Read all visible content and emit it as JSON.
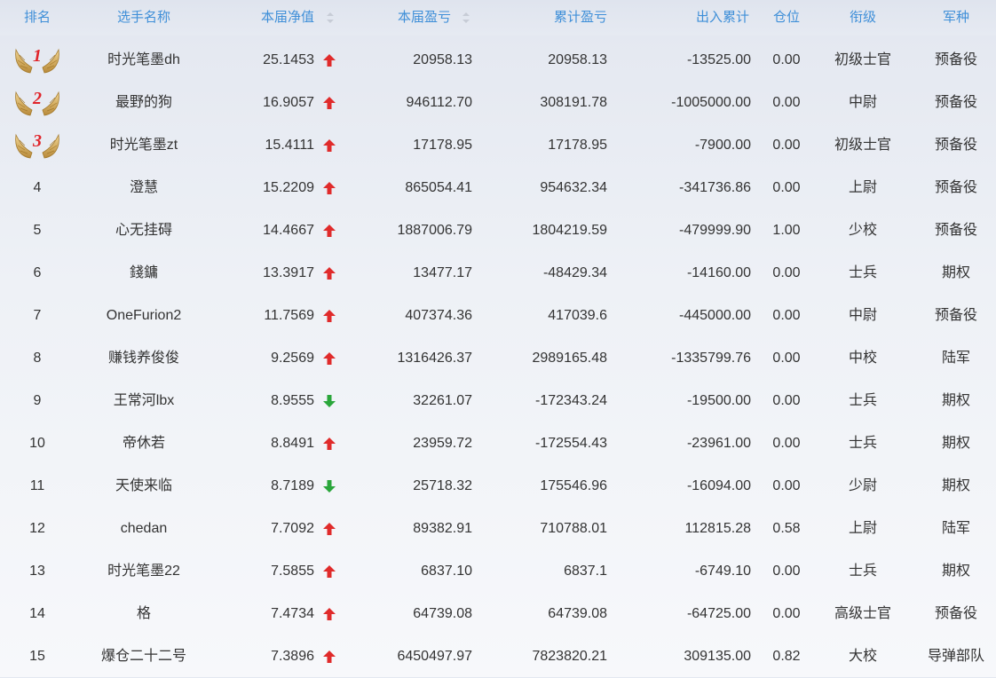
{
  "headers": {
    "rank": "排名",
    "name": "选手名称",
    "nav": "本届净值",
    "profit": "本届盈亏",
    "cumulative": "累计盈亏",
    "flow": "出入累计",
    "position": "仓位",
    "title": "衔级",
    "branch": "军种"
  },
  "colors": {
    "header_text": "#3f8fd8",
    "arrow_up": "#e02b2b",
    "arrow_down": "#2aa63b",
    "medal_number": "#e0242a"
  },
  "rows": [
    {
      "rank": "1",
      "medal": true,
      "name": "时光笔墨dh",
      "nav": "25.1453",
      "trend": "up",
      "profit": "20958.13",
      "cumulative": "20958.13",
      "flow": "-13525.00",
      "position": "0.00",
      "title": "初级士官",
      "branch": "预备役"
    },
    {
      "rank": "2",
      "medal": true,
      "name": "最野的狗",
      "nav": "16.9057",
      "trend": "up",
      "profit": "946112.70",
      "cumulative": "308191.78",
      "flow": "-1005000.00",
      "position": "0.00",
      "title": "中尉",
      "branch": "预备役"
    },
    {
      "rank": "3",
      "medal": true,
      "name": "时光笔墨zt",
      "nav": "15.4111",
      "trend": "up",
      "profit": "17178.95",
      "cumulative": "17178.95",
      "flow": "-7900.00",
      "position": "0.00",
      "title": "初级士官",
      "branch": "预备役"
    },
    {
      "rank": "4",
      "medal": false,
      "name": "澄慧",
      "nav": "15.2209",
      "trend": "up",
      "profit": "865054.41",
      "cumulative": "954632.34",
      "flow": "-341736.86",
      "position": "0.00",
      "title": "上尉",
      "branch": "预备役"
    },
    {
      "rank": "5",
      "medal": false,
      "name": "心无挂碍",
      "nav": "14.4667",
      "trend": "up",
      "profit": "1887006.79",
      "cumulative": "1804219.59",
      "flow": "-479999.90",
      "position": "1.00",
      "title": "少校",
      "branch": "预备役"
    },
    {
      "rank": "6",
      "medal": false,
      "name": "錢鏞",
      "nav": "13.3917",
      "trend": "up",
      "profit": "13477.17",
      "cumulative": "-48429.34",
      "flow": "-14160.00",
      "position": "0.00",
      "title": "士兵",
      "branch": "期权"
    },
    {
      "rank": "7",
      "medal": false,
      "name": "OneFurion2",
      "nav": "11.7569",
      "trend": "up",
      "profit": "407374.36",
      "cumulative": "417039.6",
      "flow": "-445000.00",
      "position": "0.00",
      "title": "中尉",
      "branch": "预备役"
    },
    {
      "rank": "8",
      "medal": false,
      "name": "赚钱养俊俊",
      "nav": "9.2569",
      "trend": "up",
      "profit": "1316426.37",
      "cumulative": "2989165.48",
      "flow": "-1335799.76",
      "position": "0.00",
      "title": "中校",
      "branch": "陆军"
    },
    {
      "rank": "9",
      "medal": false,
      "name": "王常河lbx",
      "nav": "8.9555",
      "trend": "down",
      "profit": "32261.07",
      "cumulative": "-172343.24",
      "flow": "-19500.00",
      "position": "0.00",
      "title": "士兵",
      "branch": "期权"
    },
    {
      "rank": "10",
      "medal": false,
      "name": "帝休若",
      "nav": "8.8491",
      "trend": "up",
      "profit": "23959.72",
      "cumulative": "-172554.43",
      "flow": "-23961.00",
      "position": "0.00",
      "title": "士兵",
      "branch": "期权"
    },
    {
      "rank": "11",
      "medal": false,
      "name": "天使来临",
      "nav": "8.7189",
      "trend": "down",
      "profit": "25718.32",
      "cumulative": "175546.96",
      "flow": "-16094.00",
      "position": "0.00",
      "title": "少尉",
      "branch": "期权"
    },
    {
      "rank": "12",
      "medal": false,
      "name": "chedan",
      "nav": "7.7092",
      "trend": "up",
      "profit": "89382.91",
      "cumulative": "710788.01",
      "flow": "112815.28",
      "position": "0.58",
      "title": "上尉",
      "branch": "陆军"
    },
    {
      "rank": "13",
      "medal": false,
      "name": "时光笔墨22",
      "nav": "7.5855",
      "trend": "up",
      "profit": "6837.10",
      "cumulative": "6837.1",
      "flow": "-6749.10",
      "position": "0.00",
      "title": "士兵",
      "branch": "期权"
    },
    {
      "rank": "14",
      "medal": false,
      "name": "格",
      "nav": "7.4734",
      "trend": "up",
      "profit": "64739.08",
      "cumulative": "64739.08",
      "flow": "-64725.00",
      "position": "0.00",
      "title": "高级士官",
      "branch": "预备役"
    },
    {
      "rank": "15",
      "medal": false,
      "name": "爆仓二十二号",
      "nav": "7.3896",
      "trend": "up",
      "profit": "6450497.97",
      "cumulative": "7823820.21",
      "flow": "309135.00",
      "position": "0.82",
      "title": "大校",
      "branch": "导弹部队"
    }
  ]
}
